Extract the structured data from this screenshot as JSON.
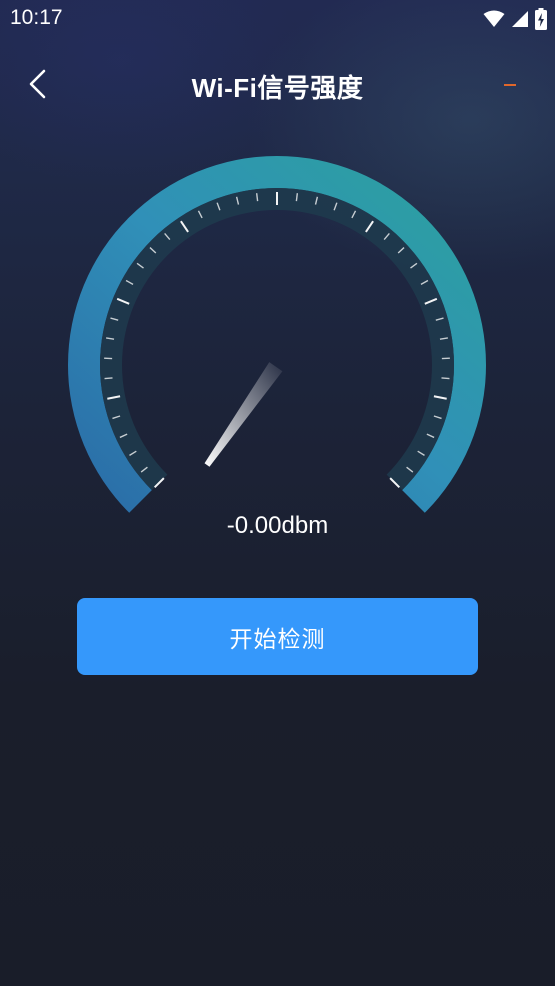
{
  "status_bar": {
    "time": "10:17",
    "icons": [
      "wifi-icon",
      "cellular-signal-icon",
      "battery-charging-icon"
    ]
  },
  "header": {
    "back_icon": "chevron-left-icon",
    "title": "Wi-Fi信号强度",
    "menu_indicator_color": "#e0672b"
  },
  "gauge": {
    "reading": "-0.00dbm",
    "needle_level": 0,
    "ring_colors": [
      "#2a72a8",
      "#2f8fb6",
      "#2a9c9a"
    ]
  },
  "actions": {
    "start_label": "开始检测",
    "button_color": "#3598fb"
  }
}
